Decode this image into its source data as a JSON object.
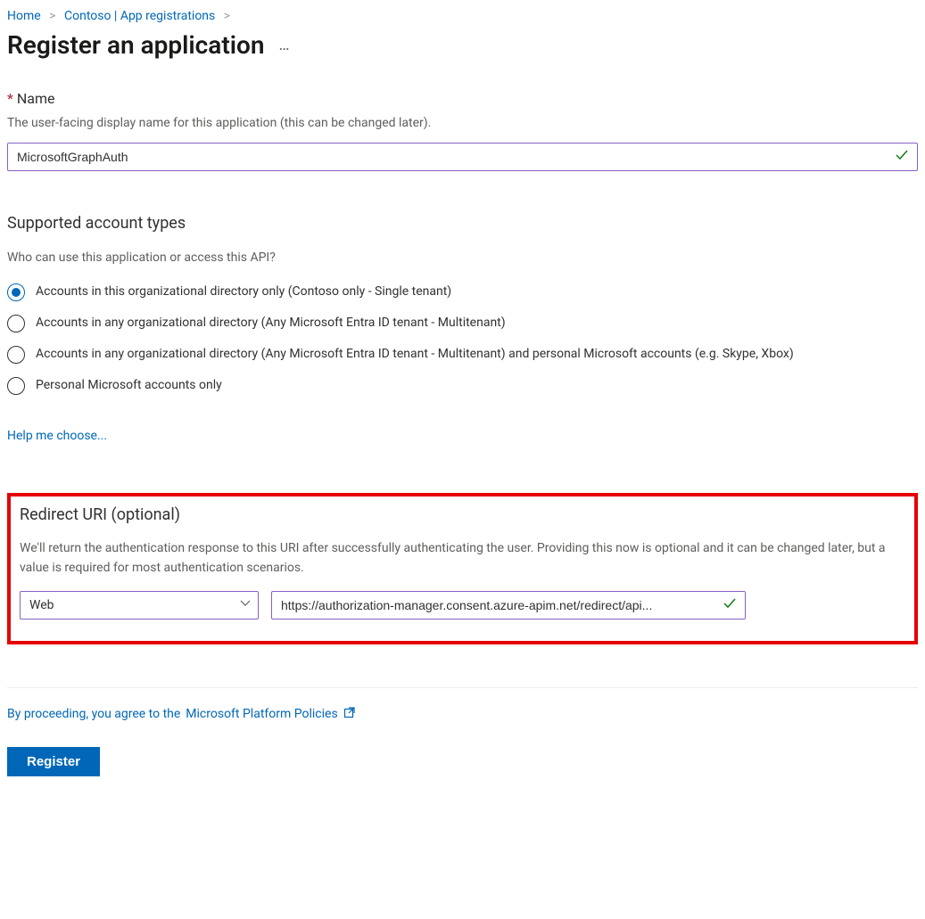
{
  "breadcrumb": {
    "home": "Home",
    "second": "Contoso | App registrations"
  },
  "pageTitle": "Register an application",
  "name": {
    "label": "Name",
    "helper": "The user-facing display name for this application (this can be changed later).",
    "value": "MicrosoftGraphAuth"
  },
  "accountTypes": {
    "heading": "Supported account types",
    "question": "Who can use this application or access this API?",
    "options": [
      "Accounts in this organizational directory only (Contoso only - Single tenant)",
      "Accounts in any organizational directory (Any Microsoft Entra ID tenant - Multitenant)",
      "Accounts in any organizational directory (Any Microsoft Entra ID tenant - Multitenant) and personal Microsoft accounts (e.g. Skype, Xbox)",
      "Personal Microsoft accounts only"
    ],
    "selectedIndex": 0,
    "helpLink": "Help me choose..."
  },
  "redirect": {
    "heading": "Redirect URI (optional)",
    "helper": "We'll return the authentication response to this URI after successfully authenticating the user. Providing this now is optional and it can be changed later, but a value is required for most authentication scenarios.",
    "platform": "Web",
    "uri": "https://authorization-manager.consent.azure-apim.net/redirect/api..."
  },
  "footer": {
    "policiesPrefix": "By proceeding, you agree to the ",
    "policiesLink": "Microsoft Platform Policies",
    "registerLabel": "Register"
  }
}
